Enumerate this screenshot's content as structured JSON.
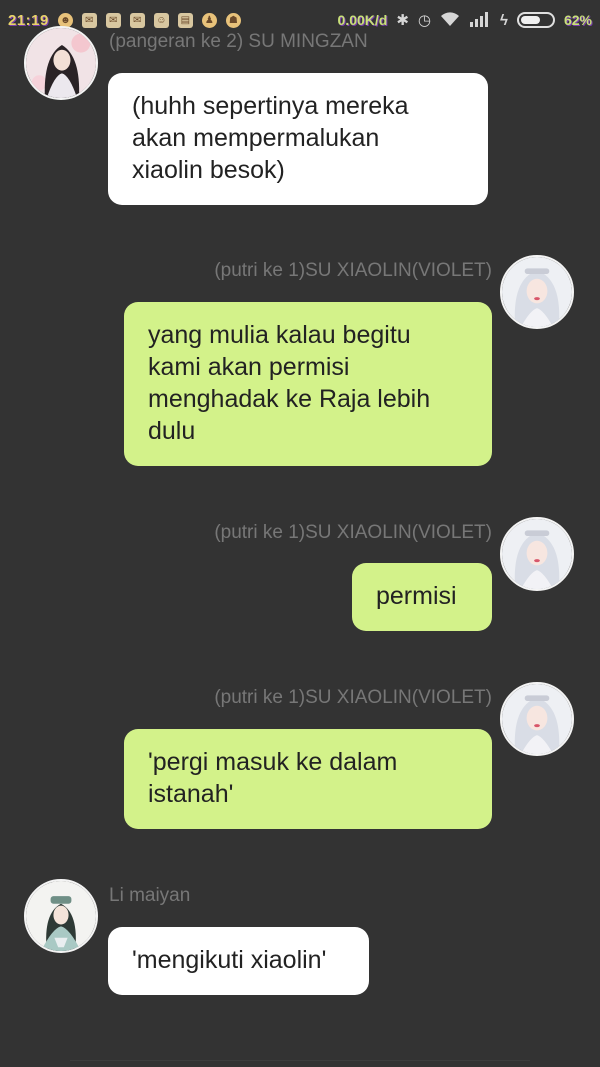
{
  "status_bar": {
    "time": "21:19",
    "net_speed": "0.00K/d",
    "battery_percent_label": "62%",
    "battery_level": 0.62,
    "icons": [
      "bluetooth-icon",
      "alarm-icon",
      "wifi-icon",
      "signal-icon",
      "charging-icon",
      "battery-icon"
    ]
  },
  "messages": [
    {
      "side": "left",
      "sender": "(pangeran ke 2) SU MINGZAN",
      "text": "(huhh sepertinya mereka\nakan mempermalukan\nxiaolin besok)"
    },
    {
      "side": "right",
      "sender": "(putri ke 1)SU XIAOLIN(VIOLET)",
      "text": "yang mulia kalau begitu\nkami akan permisi\nmenghadak ke Raja lebih\ndulu"
    },
    {
      "side": "right",
      "sender": "(putri ke 1)SU XIAOLIN(VIOLET)",
      "text": "permisi"
    },
    {
      "side": "right",
      "sender": "(putri ke 1)SU XIAOLIN(VIOLET)",
      "text": "'pergi masuk ke dalam\nistanah'"
    },
    {
      "side": "left",
      "sender": "Li maiyan",
      "text": "'mengikuti xiaolin'"
    }
  ],
  "colors": {
    "background": "#333333",
    "incoming_bubble": "#ffffff",
    "outgoing_bubble": "#d3f28a",
    "sender_name": "#777777"
  }
}
